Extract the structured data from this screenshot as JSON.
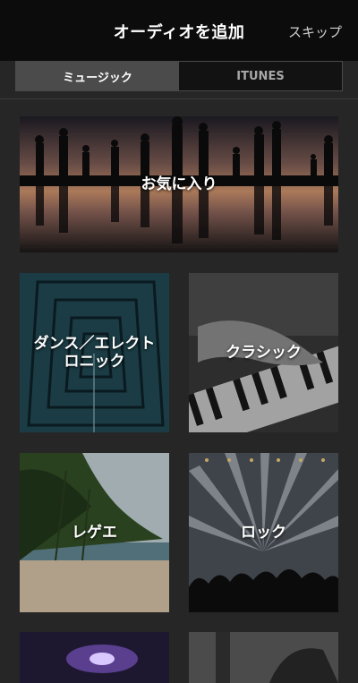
{
  "header": {
    "title": "オーディオを追加",
    "skip_label": "スキップ"
  },
  "tabs": [
    {
      "label": "ミュージック",
      "active": true
    },
    {
      "label": "ITUNES",
      "active": false
    }
  ],
  "categories": [
    {
      "label": "お気に入り"
    },
    {
      "label": "ダンス／エレクトロニック"
    },
    {
      "label": "クラシック"
    },
    {
      "label": "レゲエ"
    },
    {
      "label": "ロック"
    }
  ],
  "colors": {
    "background": "#262626",
    "topbar": "#0c0c0c",
    "tab_active": "#4b4b4b"
  }
}
